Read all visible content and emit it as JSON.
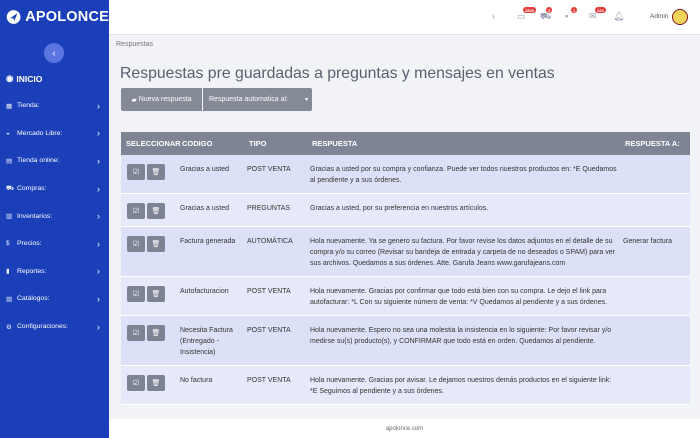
{
  "brand": {
    "name": "APOLONCE"
  },
  "sidebar": {
    "home": "INICIO",
    "items": [
      {
        "label": "Tienda:",
        "icon": "store-icon"
      },
      {
        "label": "Mercado Libre:",
        "icon": "handshake-icon"
      },
      {
        "label": "Tienda online:",
        "icon": "online-store-icon"
      },
      {
        "label": "Compras:",
        "icon": "cart-icon"
      },
      {
        "label": "Inventarios:",
        "icon": "inventory-icon"
      },
      {
        "label": "Precios:",
        "icon": "dollar-icon"
      },
      {
        "label": "Reportes:",
        "icon": "chart-icon"
      },
      {
        "label": "Catálogos:",
        "icon": "catalog-icon"
      },
      {
        "label": "Configuraciones:",
        "icon": "gear-icon"
      }
    ]
  },
  "topbar": {
    "badges": [
      "2845",
      "3",
      "1",
      "224"
    ],
    "admin": "Admin"
  },
  "breadcrumb": "Respuestas",
  "title": "Respuestas pre guardadas a preguntas y mensajes en ventas",
  "toolbar": {
    "new_label": "Nueva respuesta",
    "auto_label": "Respuesta automatica al:"
  },
  "table": {
    "headers": [
      "SELECCIONAR",
      "CODIGO",
      "TIPO",
      "RESPUESTA",
      "RESPUESTA A:"
    ],
    "rows": [
      {
        "codigo": "Gracias a usted",
        "tipo": "POST VENTA",
        "respuesta": "Gracias a usted por su compra y confianza. Puede ver todos nuestros productos en: *E Quedamos al pendiente y a sus órdenes.",
        "respuesta_a": ""
      },
      {
        "codigo": "Gracias a usted",
        "tipo": "PREGUNTAS",
        "respuesta": "Gracias a usted, por su preferencia en nuestros artículos.",
        "respuesta_a": ""
      },
      {
        "codigo": "Factura generada",
        "tipo": "AUTOMÁTICA",
        "respuesta": "Hola nuevamente. Ya se genero su factura. Por favor revise los datos adjuntos en el detalle de su compra y/o su correo (Revisar su bandeja de entrada y carpeta de no deseados o SPAM) para ver sus archivos. Quedamos a sus órdenes. Atte. Garufa Jeans www.garufajeans.com",
        "respuesta_a": "Generar factura"
      },
      {
        "codigo": "Autofacturacion",
        "tipo": "POST VENTA",
        "respuesta": "Hola nuevamente. Gracias por confirmar que todo está bien con su compra. Le dejo el link para autofacturar: *L Con su siguiente número de venta: *V Quedamos al pendiente y a sus órdenes.",
        "respuesta_a": ""
      },
      {
        "codigo": "Necesita Factura (Entregado - Insistencia)",
        "tipo": "POST VENTA",
        "respuesta": "Hola nuevamente. Espero no sea una molestia la insistencia en lo siguiente: Por favor revisar y/o medirse su(s) producto(s), y CONFIRMAR que todo está en orden. Quedamos al pendiente.",
        "respuesta_a": ""
      },
      {
        "codigo": "No factura",
        "tipo": "POST VENTA",
        "respuesta": "Hola nuevamente. Gracias por avisar. Le dejamos nuestros demás productos en el siguiente link: *E Seguimos al pendiente y a sus órdenes.",
        "respuesta_a": ""
      }
    ]
  },
  "footer": "apolonce.com"
}
